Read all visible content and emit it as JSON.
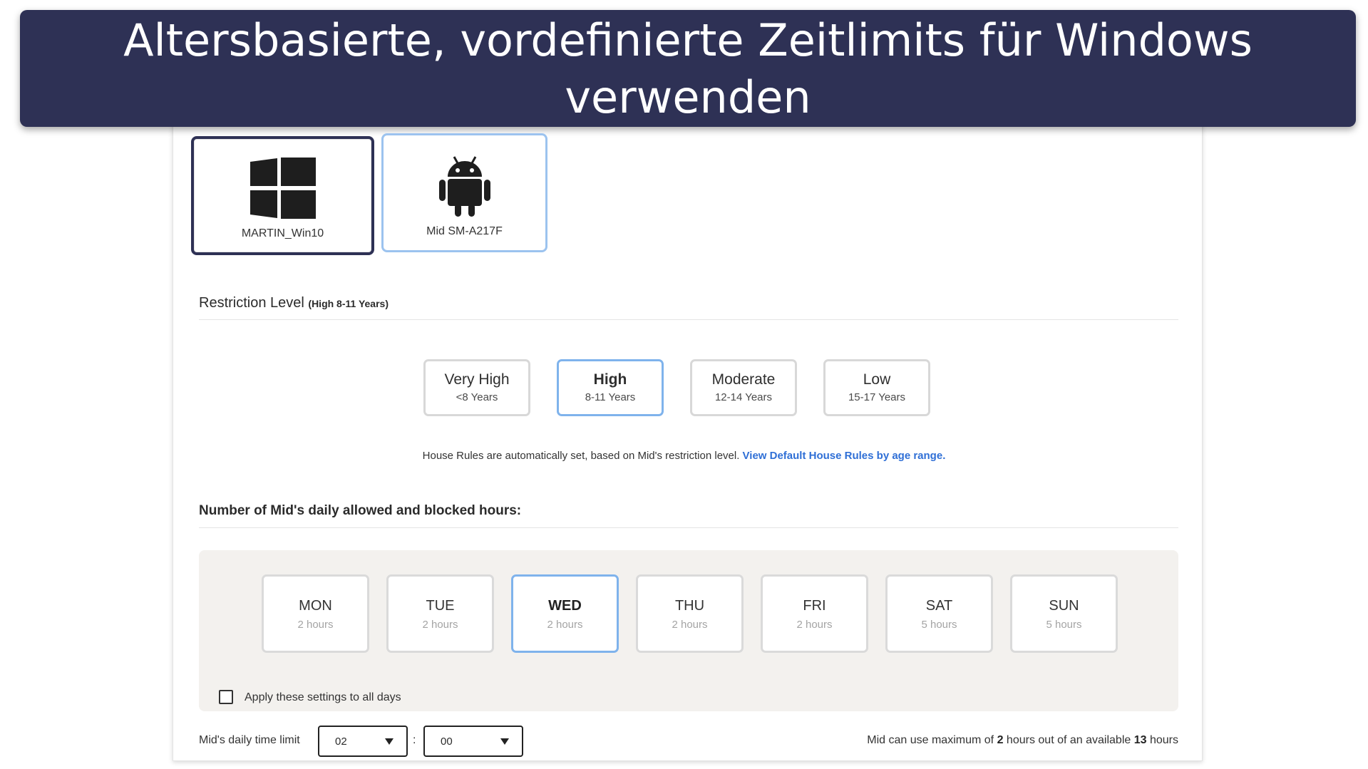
{
  "banner": {
    "line1": "Altersbasierte, vordefinierte Zeitlimits für Windows",
    "line2": "verwenden"
  },
  "devices": [
    {
      "name": "MARTIN_Win10",
      "icon": "windows-logo-icon"
    },
    {
      "name": "Mid SM-A217F",
      "icon": "android-robot-icon"
    }
  ],
  "restriction": {
    "title": "Restriction Level",
    "current": "(High 8-11 Years)",
    "levels": [
      {
        "label": "Very High",
        "range": "<8 Years"
      },
      {
        "label": "High",
        "range": "8-11 Years"
      },
      {
        "label": "Moderate",
        "range": "12-14 Years"
      },
      {
        "label": "Low",
        "range": "15-17 Years"
      }
    ],
    "selected": "High"
  },
  "note": {
    "text": "House Rules are automatically set, based on Mid's restriction level.",
    "link": "View Default House Rules by age range."
  },
  "hours": {
    "title": "Number of Mid's daily allowed and blocked hours:",
    "days": [
      {
        "day": "MON",
        "hours": "2 hours"
      },
      {
        "day": "TUE",
        "hours": "2 hours"
      },
      {
        "day": "WED",
        "hours": "2 hours"
      },
      {
        "day": "THU",
        "hours": "2 hours"
      },
      {
        "day": "FRI",
        "hours": "2 hours"
      },
      {
        "day": "SAT",
        "hours": "5 hours"
      },
      {
        "day": "SUN",
        "hours": "5 hours"
      }
    ],
    "selected_day": "WED",
    "apply_all_label": "Apply these settings to all days"
  },
  "limit": {
    "label": "Mid's daily time limit",
    "hours_value": "02",
    "separator": ":",
    "minutes_value": "00",
    "max_prefix": "Mid can use maximum of",
    "max_hours": "2",
    "max_middle": "hours out of an available",
    "available": "13",
    "max_suffix": "hours"
  },
  "colors": {
    "banner": "#2e3155",
    "accent_border": "#7fb3ec",
    "link": "#2f6fd6",
    "days_bg": "#f3f1ee"
  }
}
